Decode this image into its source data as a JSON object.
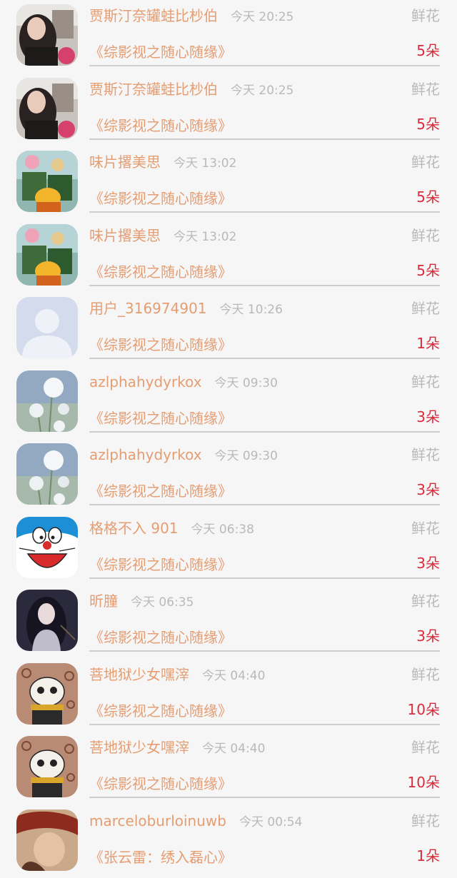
{
  "records": [
    {
      "avatar": "girl-selfie-avatar",
      "name": "贾斯汀奈罐蛙比杪伯",
      "time": "今天 20:25",
      "type": "鲜花",
      "book": "《综影视之随心随缘》",
      "count": "5朵"
    },
    {
      "avatar": "girl-selfie-avatar",
      "name": "贾斯汀奈罐蛙比杪伯",
      "time": "今天 20:25",
      "type": "鲜花",
      "book": "《综影视之随心随缘》",
      "count": "5朵"
    },
    {
      "avatar": "anime-group-avatar",
      "name": "味片撂美思",
      "time": "今天 13:02",
      "type": "鲜花",
      "book": "《综影视之随心随缘》",
      "count": "5朵"
    },
    {
      "avatar": "anime-group-avatar",
      "name": "味片撂美思",
      "time": "今天 13:02",
      "type": "鲜花",
      "book": "《综影视之随心随缘》",
      "count": "5朵"
    },
    {
      "avatar": "default-user-avatar",
      "name": "用户_316974901",
      "time": "今天 10:26",
      "type": "鲜花",
      "book": "《综影视之随心随缘》",
      "count": "1朵"
    },
    {
      "avatar": "white-flowers-avatar",
      "name": "azlphahydyrkox",
      "time": "今天 09:30",
      "type": "鲜花",
      "book": "《综影视之随心随缘》",
      "count": "3朵"
    },
    {
      "avatar": "white-flowers-avatar",
      "name": "azlphahydyrkox",
      "time": "今天 09:30",
      "type": "鲜花",
      "book": "《综影视之随心随缘》",
      "count": "3朵"
    },
    {
      "avatar": "doraemon-avatar",
      "name": "格格不入 901",
      "time": "今天 06:38",
      "type": "鲜花",
      "book": "《综影视之随心随缘》",
      "count": "3朵"
    },
    {
      "avatar": "dark-hair-girl-avatar",
      "name": "昕朣",
      "time": "今天 06:35",
      "type": "鲜花",
      "book": "《综影视之随心随缘》",
      "count": "3朵"
    },
    {
      "avatar": "cartoon-panda-avatar",
      "name": "菩地狱少女嘿滓",
      "time": "今天 04:40",
      "type": "鲜花",
      "book": "《综影视之随心随缘》",
      "count": "10朵"
    },
    {
      "avatar": "cartoon-panda-avatar",
      "name": "菩地狱少女嘿滓",
      "time": "今天 04:40",
      "type": "鲜花",
      "book": "《综影视之随心随缘》",
      "count": "10朵"
    },
    {
      "avatar": "hat-character-avatar",
      "name": "marceloburloinuwb",
      "time": "今天 00:54",
      "type": "鲜花",
      "book": "《张云雷：绣入磊心》",
      "count": "1朵"
    }
  ]
}
